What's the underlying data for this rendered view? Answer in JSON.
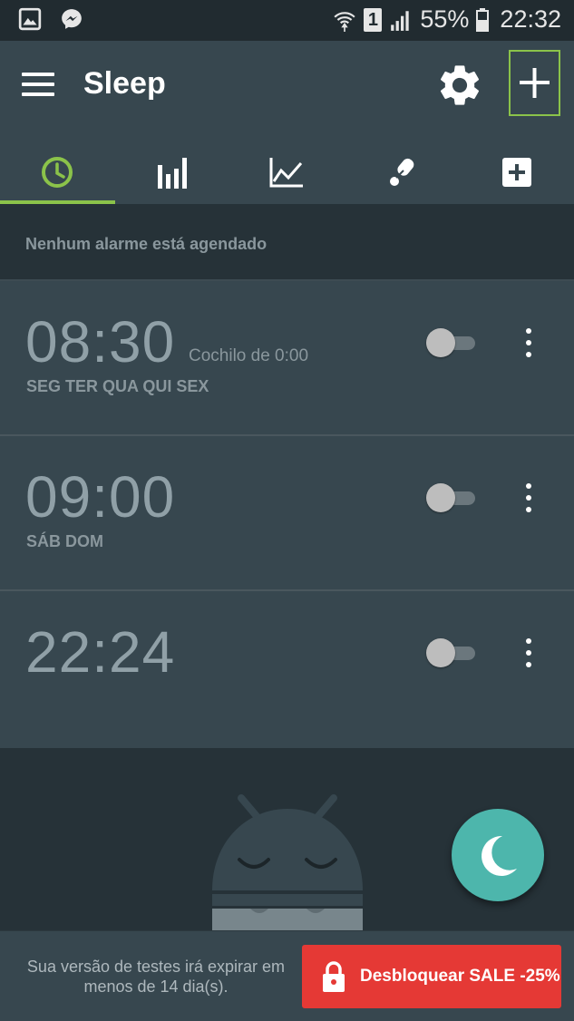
{
  "status_bar": {
    "icons_left": [
      "image-icon",
      "messenger-icon"
    ],
    "icons_right": [
      "wifi-icon",
      "sim1-icon",
      "signal-icon",
      "battery-icon"
    ],
    "sim_label": "1",
    "battery": "55%",
    "time": "22:32"
  },
  "app_bar": {
    "title": "Sleep"
  },
  "tabs": [
    {
      "icon": "alarm-clock-icon",
      "active": true
    },
    {
      "icon": "bar-chart-icon",
      "active": false
    },
    {
      "icon": "line-chart-icon",
      "active": false
    },
    {
      "icon": "microphone-icon",
      "active": false
    },
    {
      "icon": "add-box-icon",
      "active": false
    }
  ],
  "notice": "Nenhum alarme está agendado",
  "alarms": [
    {
      "time": "08:30",
      "snooze": "Cochilo de 0:00",
      "days": "SEG TER QUA QUI SEX",
      "enabled": false
    },
    {
      "time": "09:00",
      "snooze": "",
      "days": "SÁB DOM",
      "enabled": false
    },
    {
      "time": "22:24",
      "snooze": "",
      "days": "",
      "enabled": false
    }
  ],
  "banner": {
    "trial_text": "Sua versão de testes irá expirar em menos de 14 dia(s).",
    "unlock_label": "Desbloquear SALE -25%"
  },
  "colors": {
    "accent": "#8bc34a",
    "fab": "#4db6ac",
    "unlock": "#e53935"
  }
}
